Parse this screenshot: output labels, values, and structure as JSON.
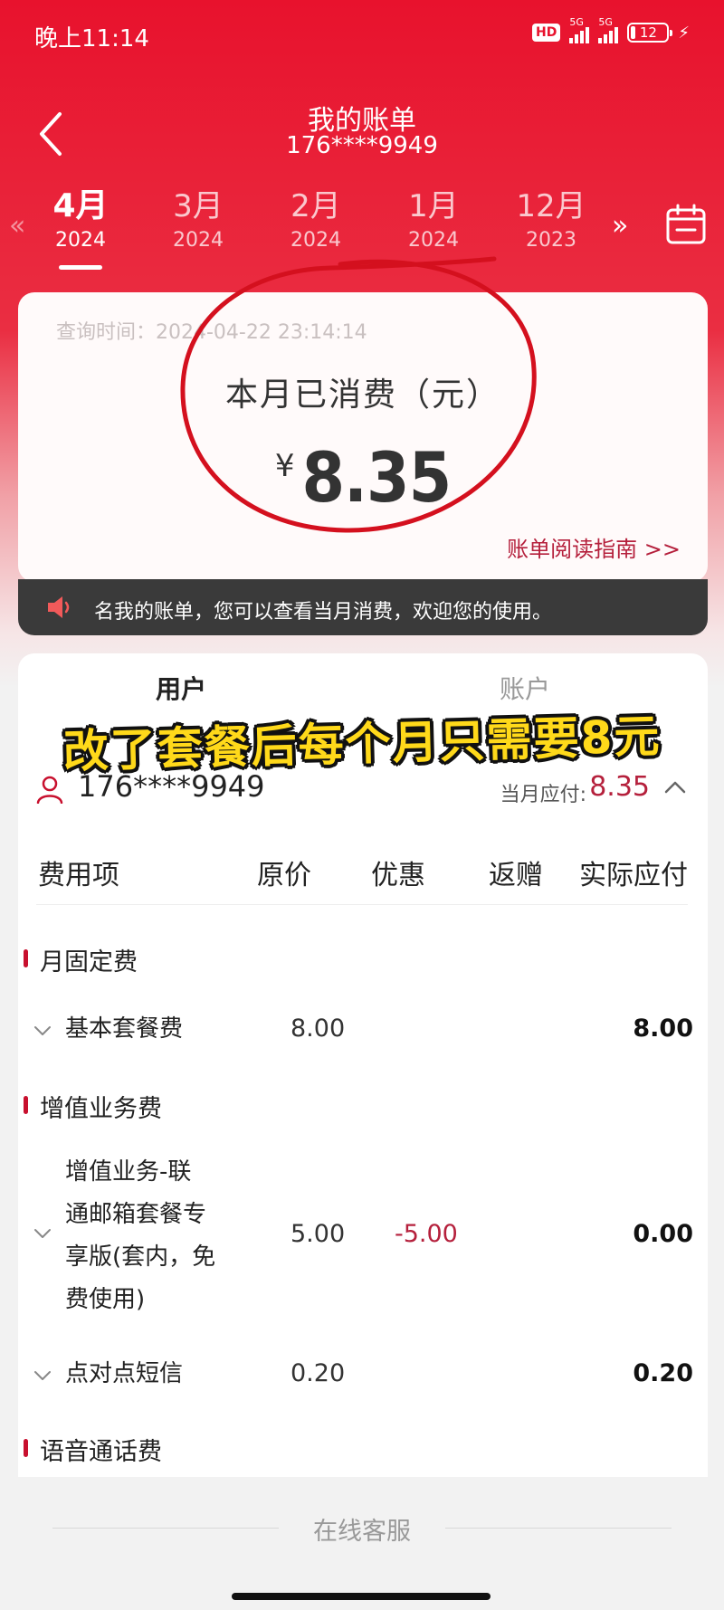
{
  "status_bar": {
    "time": "晚上11:14",
    "hd": "HD",
    "sig1": "5G",
    "sig2": "5G",
    "battery": "12"
  },
  "header": {
    "title": "我的账单",
    "phone": "176****9949"
  },
  "months": [
    {
      "month": "4月",
      "year": "2024",
      "active": true
    },
    {
      "month": "3月",
      "year": "2024"
    },
    {
      "month": "2月",
      "year": "2024"
    },
    {
      "month": "1月",
      "year": "2024"
    },
    {
      "month": "12月",
      "year": "2023"
    }
  ],
  "nav_glyphs": {
    "prev": "«",
    "next": "»"
  },
  "summary": {
    "query_time": "查询时间：2024-04-22 23:14:14",
    "consumed_label": "本月已消费（元）",
    "currency": "¥",
    "amount": "8.35",
    "guide": "账单阅读指南 >>"
  },
  "notice": {
    "text": "名我的账单，您可以查看当月消费，欢迎您的使用。"
  },
  "tabs": {
    "user": "用户",
    "account": "账户"
  },
  "overlay_caption": "改了套餐后每个月只需要8元",
  "user_row": {
    "phone": "176****9949",
    "due_label": "当月应付:",
    "due_amount": "8.35"
  },
  "table": {
    "headers": [
      "费用项",
      "原价",
      "优惠",
      "返赠",
      "实际应付"
    ],
    "sections": [
      {
        "title": "月固定费",
        "rows": [
          {
            "name": "基本套餐费",
            "orig": "8.00",
            "disc": "",
            "actual": "8.00"
          }
        ]
      },
      {
        "title": "增值业务费",
        "rows": [
          {
            "name_lines": [
              "增值业务-联",
              "通邮箱套餐专",
              "享版(套内，免",
              "费使用)"
            ],
            "orig": "5.00",
            "disc": "-5.00",
            "actual": "0.00"
          },
          {
            "name": "点对点短信",
            "orig": "0.20",
            "disc": "",
            "actual": "0.20"
          }
        ]
      },
      {
        "title": "语音通话费",
        "rows": []
      }
    ]
  },
  "footer": {
    "service": "在线客服"
  },
  "colors": {
    "brand_red": "#e8122d",
    "accent_red": "#b5203c",
    "caption_yellow": "#ffd91a"
  }
}
